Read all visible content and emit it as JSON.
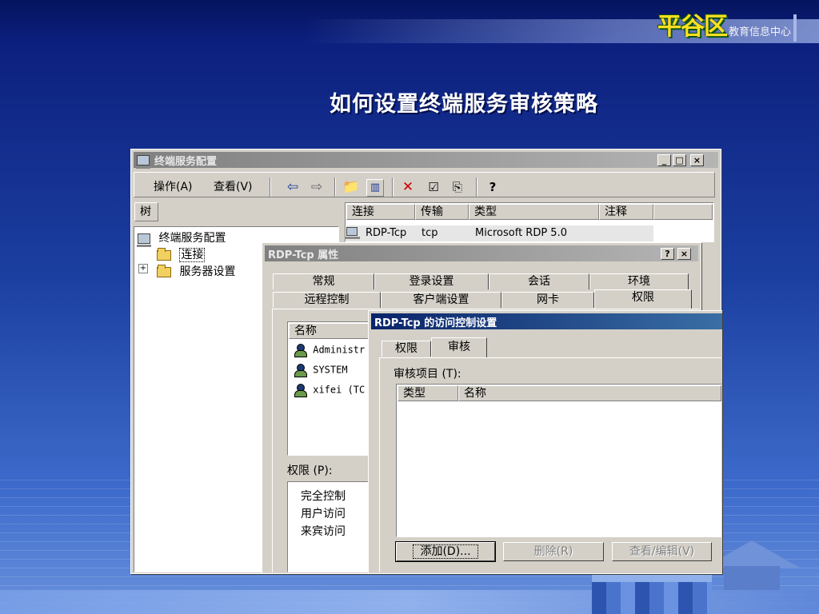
{
  "slide": {
    "title": "如何设置终端服务审核策略",
    "logo_big": "平谷区",
    "logo_small": "教育信息中心"
  },
  "main_window": {
    "title": "终端服务配置",
    "controls": [
      "_",
      "□",
      "×"
    ],
    "menu": [
      "操作(A)",
      "查看(V)"
    ],
    "toolbar_icons": [
      "back-icon",
      "forward-icon",
      "up-folder-icon",
      "show-hide-tree-icon",
      "delete-icon",
      "properties-icon",
      "export-icon",
      "help-icon"
    ],
    "tree_tab": "树",
    "tree": {
      "root": "终端服务配置",
      "items": [
        "连接",
        "服务器设置"
      ],
      "expander": "+"
    },
    "list_headers": [
      "连接",
      "传输",
      "类型",
      "注释"
    ],
    "list_row": {
      "connection": "RDP-Tcp",
      "transport": "tcp",
      "type": "Microsoft RDP 5.0"
    }
  },
  "props_dialog": {
    "title": "RDP-Tcp 属性",
    "controls": [
      "?",
      "×"
    ],
    "tabs_row1": [
      "常规",
      "登录设置",
      "会话",
      "环境"
    ],
    "tabs_row2": [
      "远程控制",
      "客户端设置",
      "网卡",
      "权限"
    ],
    "list_header": "名称",
    "users": [
      "Administr",
      "SYSTEM",
      "xifei  (TC"
    ],
    "perm_label": "权限 (P):",
    "permissions": [
      "完全控制",
      "用户访问",
      "来宾访问"
    ]
  },
  "access_dialog": {
    "title": "RDP-Tcp 的访问控制设置",
    "tabs": [
      "权限",
      "审核"
    ],
    "audit_label": "审核项目 (T):",
    "columns": [
      "类型",
      "名称"
    ],
    "buttons": {
      "add": "添加(D)...",
      "remove": "删除(R)",
      "view_edit": "查看/编辑(V)"
    }
  }
}
